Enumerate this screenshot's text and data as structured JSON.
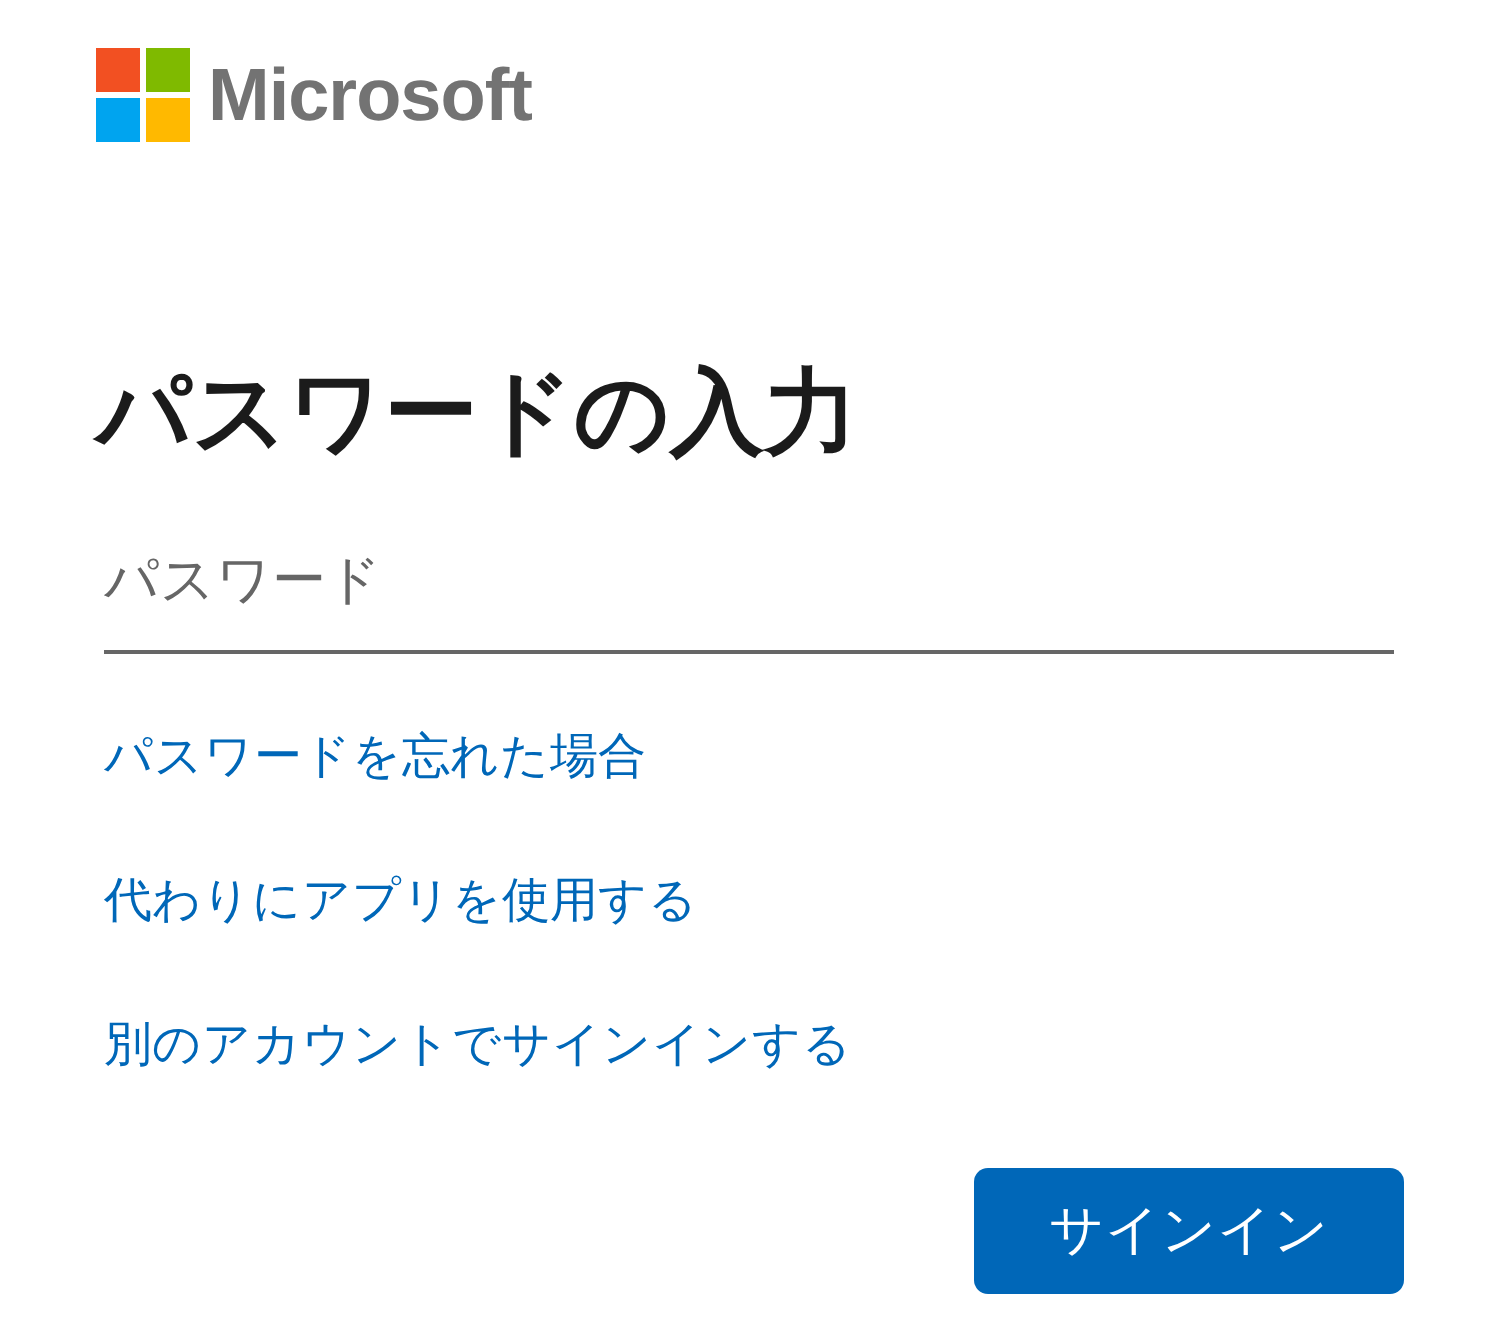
{
  "logo": {
    "wordmark": "Microsoft"
  },
  "heading": "パスワードの入力",
  "password_field": {
    "placeholder": "パスワード"
  },
  "links": [
    "パスワードを忘れた場合",
    "代わりにアプリを使用する",
    "別のアカウントでサインインする"
  ],
  "submit_button": {
    "label": "サインイン"
  }
}
